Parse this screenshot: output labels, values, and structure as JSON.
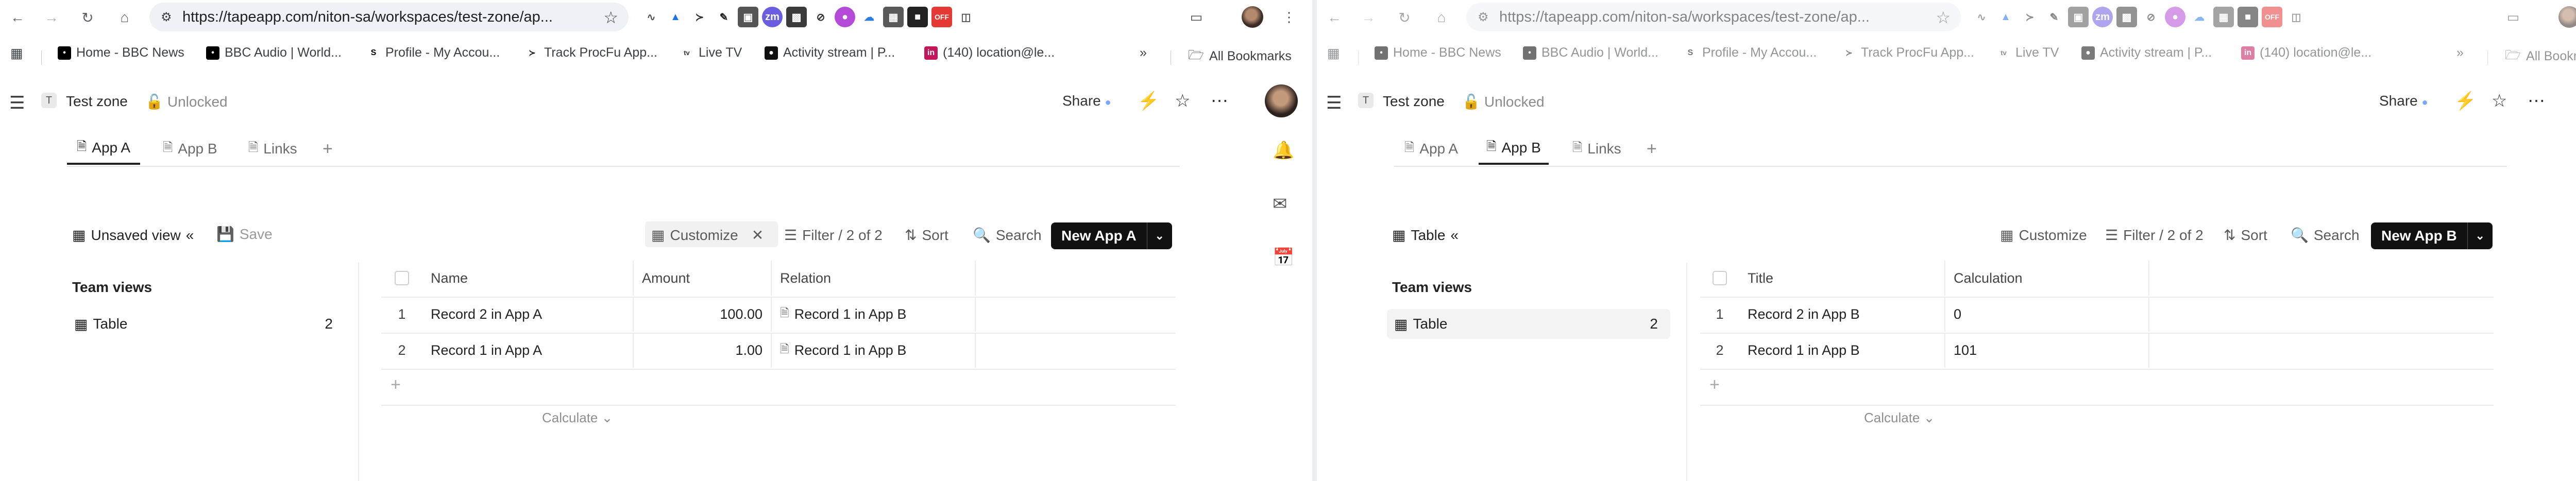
{
  "left": {
    "url": "https://tapeapp.com/niton-sa/workspaces/test-zone/ap...",
    "workspace": "Test zone",
    "lock_state": "Unlocked",
    "share": "Share",
    "tabs": [
      {
        "label": "App A"
      },
      {
        "label": "App B"
      },
      {
        "label": "Links"
      }
    ],
    "view_title": "Unsaved view",
    "save": "Save",
    "customize": "Customize",
    "filter": "Filter / 2 of 2",
    "sort": "Sort",
    "search": "Search",
    "new_button": "New App A",
    "team_views": "Team views",
    "view_item": "Table",
    "view_count": "2",
    "columns": [
      "Name",
      "Amount",
      "Relation"
    ],
    "rows": [
      {
        "idx": "1",
        "name": "Record 2 in App A",
        "amount": "100.00",
        "relation": "Record 1 in App B"
      },
      {
        "idx": "2",
        "name": "Record 1 in App A",
        "amount": "1.00",
        "relation": "Record 1 in App B"
      }
    ],
    "calculate": "Calculate"
  },
  "right": {
    "url": "https://tapeapp.com/niton-sa/workspaces/test-zone/ap...",
    "workspace": "Test zone",
    "lock_state": "Unlocked",
    "share": "Share",
    "tabs": [
      {
        "label": "App A"
      },
      {
        "label": "App B"
      },
      {
        "label": "Links"
      }
    ],
    "view_title": "Table",
    "customize": "Customize",
    "filter": "Filter / 2 of 2",
    "sort": "Sort",
    "search": "Search",
    "new_button": "New App B",
    "team_views": "Team views",
    "view_item": "Table",
    "view_count": "2",
    "columns": [
      "Title",
      "Calculation"
    ],
    "rows": [
      {
        "idx": "1",
        "title": "Record 2 in App B",
        "calc": "0"
      },
      {
        "idx": "2",
        "title": "Record 1 in App B",
        "calc": "101"
      }
    ],
    "calculate": "Calculate"
  },
  "bookmarks": [
    {
      "label": "Home - BBC News",
      "icon": "bbc"
    },
    {
      "label": "BBC Audio | World...",
      "icon": "bbc"
    },
    {
      "label": "Profile - My Accou...",
      "icon": "s-logo"
    },
    {
      "label": "Track ProcFu App...",
      "icon": "procfu"
    },
    {
      "label": "Live TV",
      "icon": "tv"
    },
    {
      "label": "Activity stream | P...",
      "icon": "podio"
    },
    {
      "label": "(140) location@le...",
      "icon": "linkedin"
    }
  ],
  "all_bookmarks": "All Bookmarks",
  "extension_badge": "OFF",
  "colors": {
    "accent": "#111111",
    "active_tab": "#222222",
    "border": "#ececec"
  }
}
